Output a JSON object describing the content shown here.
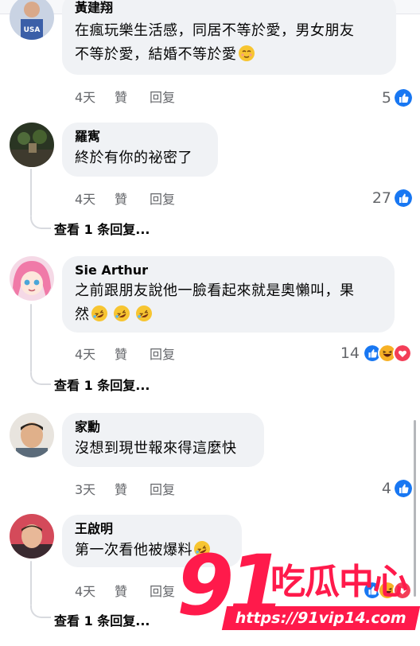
{
  "comments": [
    {
      "author": "黃建翔",
      "lines": [
        "在瘋玩樂生活感，同居不等於愛，男女朋友",
        "不等於愛，結婚不等於愛"
      ],
      "time": "4天",
      "like": "贊",
      "reply": "回复",
      "reaction_count": "5"
    },
    {
      "author": "羅寯",
      "lines": [
        "終於有你的祕密了"
      ],
      "time": "4天",
      "like": "贊",
      "reply": "回复",
      "reaction_count": "27",
      "view_replies": "查看 1 条回复..."
    },
    {
      "author": "Sie Arthur",
      "lines": [
        "之前跟朋友說他一臉看起來就是奧懶叫，果",
        "然"
      ],
      "time": "4天",
      "like": "贊",
      "reply": "回复",
      "reaction_count": "14",
      "view_replies": "查看 1 条回复..."
    },
    {
      "author": "家勳",
      "lines": [
        "沒想到現世報來得這麼快"
      ],
      "time": "3天",
      "like": "贊",
      "reply": "回复",
      "reaction_count": "4"
    },
    {
      "author": "王啟明",
      "lines": [
        "第一次看他被爆料"
      ],
      "time": "4天",
      "like": "贊",
      "reply": "回复",
      "view_replies": "查看 1 条回复..."
    }
  ],
  "watermark": {
    "number": "91",
    "brand": "吃瓜中心",
    "url": "https://91vip14.com"
  },
  "colors": {
    "bubble": "#f0f2f5",
    "meta_text": "#65676b",
    "like_blue": "#1877f2",
    "love_red": "#f33e58",
    "haha_yellow": "#f7b125",
    "watermark_red": "#ff1a4b"
  }
}
